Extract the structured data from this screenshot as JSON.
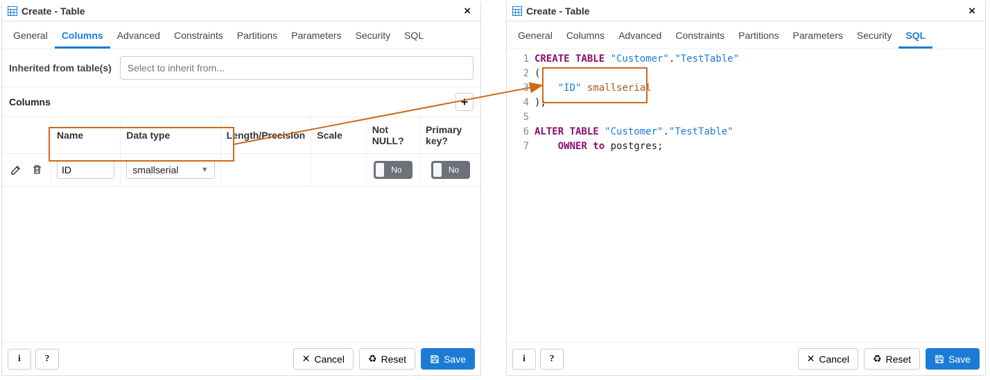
{
  "titles": {
    "left": "Create - Table",
    "right": "Create - Table"
  },
  "tabs": [
    "General",
    "Columns",
    "Advanced",
    "Constraints",
    "Partitions",
    "Parameters",
    "Security",
    "SQL"
  ],
  "activeTab": {
    "left": "Columns",
    "right": "SQL"
  },
  "inherit": {
    "label": "Inherited from table(s)",
    "placeholder": "Select to inherit from..."
  },
  "columnsSection": {
    "heading": "Columns"
  },
  "colHeaders": {
    "name": "Name",
    "datatype": "Data type",
    "length": "Length/Precision",
    "scale": "Scale",
    "notnull": "Not NULL?",
    "pk": "Primary key?"
  },
  "row": {
    "name": "ID",
    "datatype": "smallserial",
    "length": "",
    "scale": "",
    "notnull": "No",
    "pk": "No"
  },
  "footer": {
    "info": "i",
    "help": "?",
    "cancel": "Cancel",
    "reset": "Reset",
    "save": "Save"
  },
  "sql": {
    "lineNumbers": [
      "1",
      "2",
      "3",
      "4",
      "5",
      "6",
      "7"
    ],
    "line1": {
      "a": "CREATE TABLE ",
      "b": "\"Customer\"",
      "c": ".",
      "d": "\"TestTable\""
    },
    "line2": "(",
    "line3": {
      "pad": "    ",
      "a": "\"ID\" ",
      "b": "smallserial"
    },
    "line4": ");",
    "line5": "",
    "line6": {
      "a": "ALTER TABLE ",
      "b": "\"Customer\"",
      "c": ".",
      "d": "\"TestTable\""
    },
    "line7": {
      "pad": "    ",
      "a": "OWNER to ",
      "b": "postgres;"
    }
  }
}
